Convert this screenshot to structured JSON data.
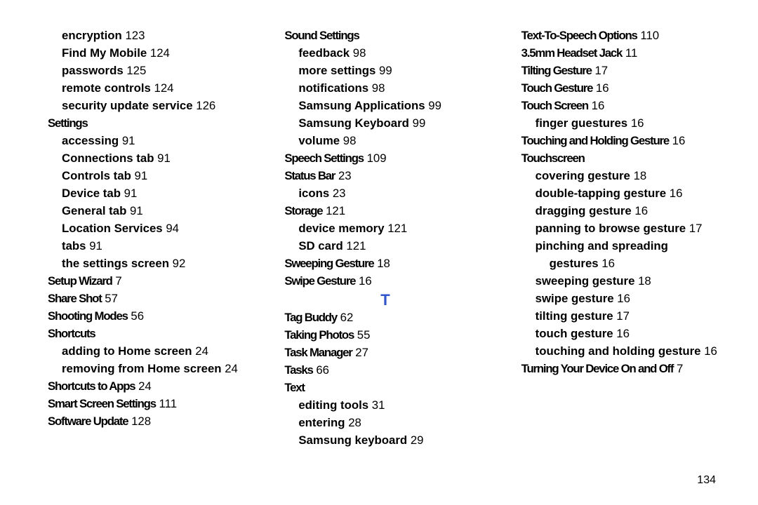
{
  "page_number": "134",
  "section_letter": "T",
  "columns": [
    {
      "rows": [
        {
          "type": "sub",
          "label": "encryption",
          "page": "123"
        },
        {
          "type": "sub",
          "label": "Find My Mobile",
          "page": "124"
        },
        {
          "type": "sub",
          "label": "passwords",
          "page": "125"
        },
        {
          "type": "sub",
          "label": "remote controls",
          "page": "124"
        },
        {
          "type": "sub",
          "label": "security update service",
          "page": "126"
        },
        {
          "type": "bold",
          "label": "Settings",
          "narrow": true
        },
        {
          "type": "sub",
          "label": "accessing",
          "page": "91"
        },
        {
          "type": "sub",
          "label": "Connections tab",
          "page": "91"
        },
        {
          "type": "sub",
          "label": "Controls tab",
          "page": "91"
        },
        {
          "type": "sub",
          "label": "Device tab",
          "page": "91"
        },
        {
          "type": "sub",
          "label": "General tab",
          "page": "91"
        },
        {
          "type": "sub",
          "label": "Location Services",
          "page": "94"
        },
        {
          "type": "sub",
          "label": "tabs",
          "page": "91"
        },
        {
          "type": "sub",
          "label": "the settings screen",
          "page": "92"
        },
        {
          "type": "bold",
          "label": "Setup Wizard",
          "page": "7",
          "narrow": true
        },
        {
          "type": "bold",
          "label": "Share Shot",
          "page": "57",
          "narrow": true
        },
        {
          "type": "bold",
          "label": "Shooting Modes",
          "page": "56",
          "narrow": true
        },
        {
          "type": "bold",
          "label": "Shortcuts",
          "narrow": true
        },
        {
          "type": "sub",
          "label": "adding to Home screen",
          "page": "24"
        },
        {
          "type": "sub",
          "label": "removing from Home screen",
          "page": "24"
        },
        {
          "type": "bold",
          "label": "Shortcuts to Apps",
          "page": "24",
          "narrow": true
        },
        {
          "type": "bold",
          "label": "Smart Screen Settings",
          "page": "111",
          "narrow": true
        },
        {
          "type": "bold",
          "label": "Software Update",
          "page": "128",
          "narrow": true
        }
      ]
    },
    {
      "rows": [
        {
          "type": "bold",
          "label": "Sound Settings",
          "narrow": true
        },
        {
          "type": "sub",
          "label": "feedback",
          "page": "98"
        },
        {
          "type": "sub",
          "label": "more settings",
          "page": "99"
        },
        {
          "type": "sub",
          "label": "notifications",
          "page": "98"
        },
        {
          "type": "sub",
          "label": "Samsung Applications",
          "page": "99"
        },
        {
          "type": "sub",
          "label": "Samsung Keyboard",
          "page": "99"
        },
        {
          "type": "sub",
          "label": "volume",
          "page": "98"
        },
        {
          "type": "bold",
          "label": "Speech Settings",
          "page": "109",
          "narrow": true
        },
        {
          "type": "bold",
          "label": "Status Bar",
          "page": "23",
          "narrow": true
        },
        {
          "type": "sub",
          "label": "icons",
          "page": "23"
        },
        {
          "type": "bold",
          "label": "Storage",
          "page": "121",
          "narrow": true
        },
        {
          "type": "sub",
          "label": "device memory",
          "page": "121"
        },
        {
          "type": "sub",
          "label": "SD card",
          "page": "121"
        },
        {
          "type": "bold",
          "label": "Sweeping Gesture",
          "page": "18",
          "narrow": true
        },
        {
          "type": "bold",
          "label": "Swipe Gesture",
          "page": "16",
          "narrow": true
        },
        {
          "type": "letter"
        },
        {
          "type": "bold",
          "label": "Tag Buddy",
          "page": "62",
          "narrow": true
        },
        {
          "type": "bold",
          "label": "Taking Photos",
          "page": "55",
          "narrow": true
        },
        {
          "type": "bold",
          "label": "Task Manager",
          "page": "27",
          "narrow": true
        },
        {
          "type": "bold",
          "label": "Tasks",
          "page": "66",
          "narrow": true
        },
        {
          "type": "bold",
          "label": "Text",
          "narrow": true
        },
        {
          "type": "sub",
          "label": "editing tools",
          "page": "31"
        },
        {
          "type": "sub",
          "label": "entering",
          "page": "28"
        },
        {
          "type": "sub",
          "label": "Samsung keyboard",
          "page": "29"
        }
      ]
    },
    {
      "rows": [
        {
          "type": "bold",
          "label": "Text-To-Speech Options",
          "page": "110",
          "narrow": true
        },
        {
          "type": "bold",
          "label": "3.5mm Headset Jack",
          "page": "11",
          "narrow": true,
          "spaced": true
        },
        {
          "type": "bold",
          "label": "Tilting Gesture",
          "page": "17",
          "narrow": true
        },
        {
          "type": "bold",
          "label": "Touch Gesture",
          "page": "16",
          "narrow": true
        },
        {
          "type": "bold",
          "label": "Touch Screen",
          "page": "16",
          "narrow": true
        },
        {
          "type": "sub",
          "label": "finger guestures",
          "page": "16"
        },
        {
          "type": "bold",
          "label": "Touching and Holding Gesture",
          "page": "16",
          "narrow": true
        },
        {
          "type": "bold",
          "label": "Touchscreen",
          "narrow": true
        },
        {
          "type": "sub",
          "label": "covering gesture",
          "page": "18"
        },
        {
          "type": "sub",
          "label": "double-tapping gesture",
          "page": "16"
        },
        {
          "type": "sub",
          "label": "dragging gesture",
          "page": "16"
        },
        {
          "type": "sub",
          "label": "panning to browse gesture",
          "page": "17"
        },
        {
          "type": "sub",
          "label": "pinching and spreading"
        },
        {
          "type": "sub2",
          "label": "gestures",
          "page": "16"
        },
        {
          "type": "sub",
          "label": "sweeping gesture",
          "page": "18"
        },
        {
          "type": "sub",
          "label": "swipe gesture",
          "page": "16"
        },
        {
          "type": "sub",
          "label": "tilting gesture",
          "page": "17"
        },
        {
          "type": "sub",
          "label": "touch gesture",
          "page": "16"
        },
        {
          "type": "sub",
          "label": "touching and holding gesture",
          "page": "16"
        },
        {
          "type": "bold",
          "label": "Turning Your Device On and Off",
          "page": "7",
          "narrow": true
        }
      ]
    }
  ]
}
